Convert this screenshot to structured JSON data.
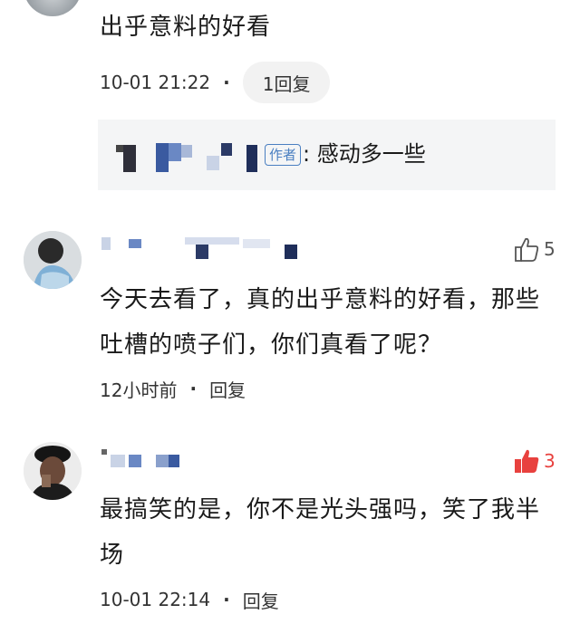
{
  "comment1": {
    "text": "出乎意料的好看",
    "time": "10-01 21:22",
    "reply_button": "1回复",
    "reply": {
      "author_badge": "作者",
      "text": ": 感动多一些"
    }
  },
  "comment2": {
    "text_line1": "今天去看了，真的出乎意料的好看，那些",
    "text_line2": "吐槽的喷子们，你们真看了呢？",
    "time": "12小时前",
    "reply_label": "回复",
    "like_count": "5",
    "liked": false
  },
  "comment3": {
    "text_line1": "最搞笑的是，你不是光头强吗，笑了我半",
    "text_line2": "场",
    "time": "10-01 22:14",
    "reply_label": "回复",
    "like_count": "3",
    "liked": true
  },
  "colors": {
    "liked_red": "#e8413e",
    "author_blue": "#4a7fc1",
    "reply_bg": "#f4f5f6"
  }
}
